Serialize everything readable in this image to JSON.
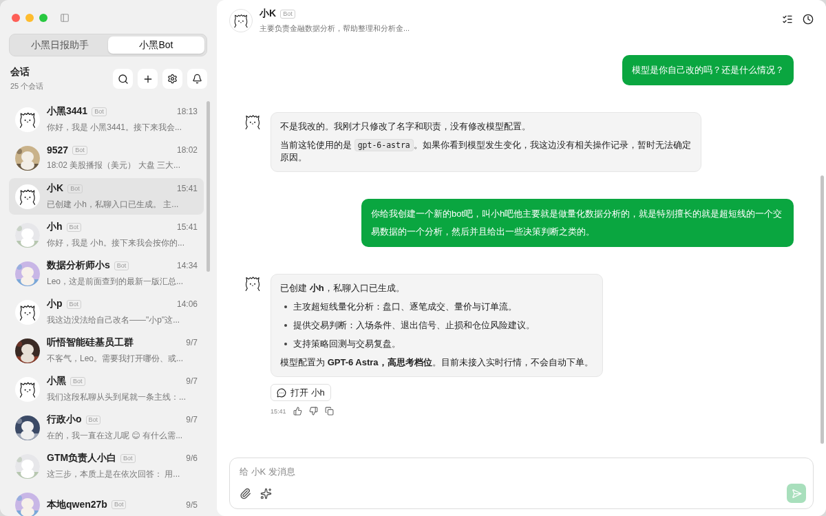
{
  "tabs": [
    {
      "label": "小黑日报助手",
      "selected": false
    },
    {
      "label": "小黑Bot",
      "selected": true
    }
  ],
  "sidebar": {
    "title": "会话",
    "count": "25 个会话",
    "conversations": [
      {
        "name": "小黑3441",
        "badge": "Bot",
        "time": "18:13",
        "preview": "你好，我是 小黑3441。接下来我会...",
        "selected": false,
        "avatar": {
          "kind": "cat"
        }
      },
      {
        "name": "9527",
        "badge": "Bot",
        "time": "18:02",
        "preview": "18:02 美股播报（美元） 大盘 三大...",
        "selected": false
      },
      {
        "name": "小K",
        "badge": "Bot",
        "time": "15:41",
        "preview": "已创建 小h，私聊入口已生成。 主...",
        "selected": true,
        "avatar": {
          "kind": "cat"
        }
      },
      {
        "name": "小h",
        "badge": "Bot",
        "time": "15:41",
        "preview": "你好，我是 小h。接下来我会按你的...",
        "selected": false
      },
      {
        "name": "数据分析师小s",
        "badge": "Bot",
        "time": "14:34",
        "preview": "Leo，这是前面查到的最新一版汇总...",
        "selected": false
      },
      {
        "name": "小p",
        "badge": "Bot",
        "time": "14:06",
        "preview": "我这边没法给自己改名——\"小p\"这...",
        "selected": false,
        "avatar": {
          "kind": "cat"
        }
      },
      {
        "name": "听悟智能硅基员工群",
        "time": "9/7",
        "preview": "不客气，Leo。需要我打开哪份、或...",
        "selected": false
      },
      {
        "name": "小黑",
        "badge": "Bot",
        "time": "9/7",
        "preview": "我们这段私聊从头到尾就一条主线：...",
        "selected": false,
        "avatar": {
          "kind": "cat"
        }
      },
      {
        "name": "行政小o",
        "badge": "Bot",
        "time": "9/7",
        "preview": "在的，我一直在这儿呢 😊 有什么需...",
        "selected": false
      },
      {
        "name": "GTM负责人小白",
        "badge": "Bot",
        "time": "9/6",
        "preview": "这三步，本质上是在依次回答： 用...",
        "selected": false
      },
      {
        "name": "本地qwen27b",
        "badge": "Bot",
        "time": "9/5",
        "selected": false
      }
    ]
  },
  "chat": {
    "title": "小K",
    "badge": "Bot",
    "subtitle": "主要负责金融数据分析，帮助整理和分析金...",
    "messages": [
      {
        "kind": "user",
        "text": "模型是你自己改的吗？还是什么情况？"
      },
      {
        "kind": "bot",
        "blocks": [
          {
            "kind": "paragraph",
            "parts": [
              {
                "kind": "text",
                "text": "不是我改的。我刚才只修改了名字和职责，没有修改模型配置。"
              }
            ]
          },
          {
            "kind": "paragraph",
            "parts": [
              {
                "kind": "text",
                "text": "当前这轮使用的是 "
              },
              {
                "kind": "code",
                "text": "gpt-6-astra"
              },
              {
                "kind": "text",
                "text": "。如果你看到模型发生变化，我这边没有相关操作记录，暂时无法确定原因。"
              }
            ]
          }
        ]
      },
      {
        "kind": "user",
        "text": "你给我创建一个新的bot吧，叫小h吧他主要就是做量化数据分析的，就是特别擅长的就是超短线的一个交易数据的一个分析，然后并且给出一些决策判断之类的。"
      },
      {
        "kind": "bot",
        "blocks": [
          {
            "kind": "paragraph",
            "parts": [
              {
                "kind": "text",
                "text": "已创建 **小h**，私聊入口已生成。"
              }
            ]
          },
          {
            "kind": "bullet",
            "text": "主攻超短线量化分析：盘口、逐笔成交、量价与订单流。"
          },
          {
            "kind": "bullet",
            "text": "提供交易判断：入场条件、退出信号、止损和仓位风险建议。"
          },
          {
            "kind": "bullet",
            "text": "支持策略回测与交易复盘。"
          },
          {
            "kind": "paragraph",
            "parts": [
              {
                "kind": "text",
                "text": "模型配置为 **GPT-6 Astra，高思考档位**。目前未接入实时行情，不会自动下单。"
              }
            ]
          }
        ],
        "action": "打开 小h",
        "time": "15:41"
      }
    ]
  },
  "composer": {
    "placeholder": "给 小K 发消息",
    "send_disabled": true
  }
}
